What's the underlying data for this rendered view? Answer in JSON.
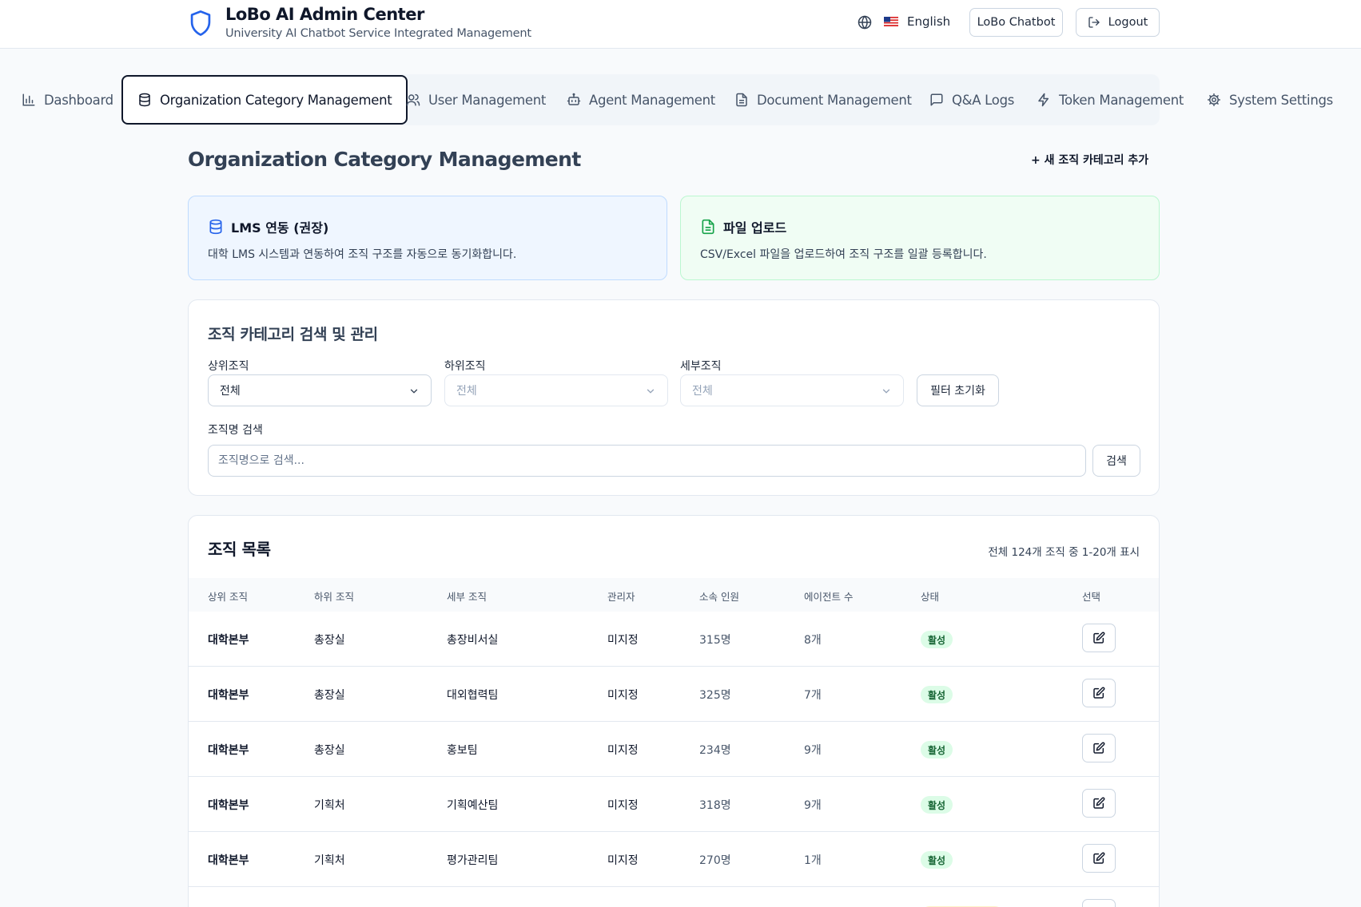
{
  "header": {
    "title": "LoBo AI Admin Center",
    "subtitle": "University AI Chatbot Service Integrated Management",
    "language": "English",
    "chatbot_label": "LoBo Chatbot",
    "logout_label": "Logout",
    "brand_color": "#2563eb"
  },
  "tabs": [
    {
      "label": "Dashboard",
      "icon": "bar-chart-icon"
    },
    {
      "label": "Organization Category Management",
      "icon": "database-icon",
      "active": true
    },
    {
      "label": "User Management",
      "icon": "users-icon"
    },
    {
      "label": "Agent Management",
      "icon": "bot-icon"
    },
    {
      "label": "Document Management",
      "icon": "file-text-icon"
    },
    {
      "label": "Q&A Logs",
      "icon": "message-square-icon"
    },
    {
      "label": "Token Management",
      "icon": "zap-icon"
    },
    {
      "label": "System Settings",
      "icon": "settings-icon"
    }
  ],
  "page": {
    "title": "Organization Category Management",
    "add_label": "+ 새 조직 카테고리 추가"
  },
  "cards": {
    "lms": {
      "title": "LMS 연동 (권장)",
      "desc": "대학 LMS 시스템과 연동하여 조직 구조를 자동으로 동기화합니다.",
      "color": "#eff6ff"
    },
    "file": {
      "title": "파일 업로드",
      "desc": "CSV/Excel 파일을 업로드하여 조직 구조를 일괄 등록합니다.",
      "color": "#f0fdf4"
    }
  },
  "search": {
    "title": "조직 카테고리 검색 및 관리",
    "upper_label": "상위조직",
    "upper_value": "전체",
    "lower_label": "하위조직",
    "lower_value": "전체",
    "detail_label": "세부조직",
    "detail_value": "전체",
    "reset_label": "필터 초기화",
    "name_label": "조직명 검색",
    "name_placeholder": "조직명으로 검색...",
    "search_label": "검색"
  },
  "list": {
    "title": "조직 목록",
    "count": "전체 124개 조직 중 1-20개 표시",
    "columns": [
      "상위 조직",
      "하위 조직",
      "세부 조직",
      "관리자",
      "소속 인원",
      "에이전트 수",
      "상태",
      "선택"
    ],
    "rows": [
      {
        "upper": "대학본부",
        "lower": "총장실",
        "detail": "총장비서실",
        "manager": "미지정",
        "members": "315명",
        "agents": "8개",
        "status": "활성"
      },
      {
        "upper": "대학본부",
        "lower": "총장실",
        "detail": "대외협력팀",
        "manager": "미지정",
        "members": "325명",
        "agents": "7개",
        "status": "활성"
      },
      {
        "upper": "대학본부",
        "lower": "총장실",
        "detail": "홍보팀",
        "manager": "미지정",
        "members": "234명",
        "agents": "9개",
        "status": "활성"
      },
      {
        "upper": "대학본부",
        "lower": "기획처",
        "detail": "기획예산팀",
        "manager": "미지정",
        "members": "318명",
        "agents": "9개",
        "status": "활성"
      },
      {
        "upper": "대학본부",
        "lower": "기획처",
        "detail": "평가관리팀",
        "manager": "미지정",
        "members": "270명",
        "agents": "1개",
        "status": "활성"
      }
    ]
  }
}
